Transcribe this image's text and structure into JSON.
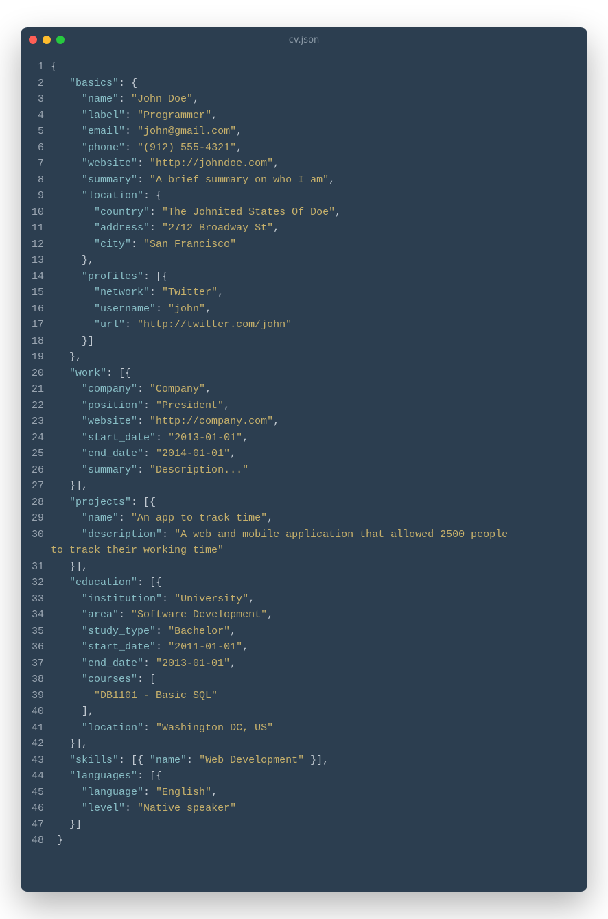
{
  "window": {
    "title": "cv.json"
  },
  "line_numbers": [
    "1",
    "2",
    "3",
    "4",
    "5",
    "6",
    "7",
    "8",
    "9",
    "10",
    "11",
    "12",
    "13",
    "14",
    "15",
    "16",
    "17",
    "18",
    "19",
    "20",
    "21",
    "22",
    "23",
    "24",
    "25",
    "26",
    "27",
    "28",
    "29",
    "30",
    "",
    "31",
    "32",
    "33",
    "34",
    "35",
    "36",
    "37",
    "38",
    "39",
    "40",
    "41",
    "42",
    "43",
    "44",
    "45",
    "46",
    "47",
    "48"
  ],
  "code_lines": [
    [
      {
        "t": "p",
        "x": "{"
      }
    ],
    [
      {
        "t": "p",
        "x": "   "
      },
      {
        "t": "k",
        "x": "\"basics\""
      },
      {
        "t": "p",
        "x": ": {"
      }
    ],
    [
      {
        "t": "p",
        "x": "     "
      },
      {
        "t": "k",
        "x": "\"name\""
      },
      {
        "t": "p",
        "x": ": "
      },
      {
        "t": "s",
        "x": "\"John Doe\""
      },
      {
        "t": "p",
        "x": ","
      }
    ],
    [
      {
        "t": "p",
        "x": "     "
      },
      {
        "t": "k",
        "x": "\"label\""
      },
      {
        "t": "p",
        "x": ": "
      },
      {
        "t": "s",
        "x": "\"Programmer\""
      },
      {
        "t": "p",
        "x": ","
      }
    ],
    [
      {
        "t": "p",
        "x": "     "
      },
      {
        "t": "k",
        "x": "\"email\""
      },
      {
        "t": "p",
        "x": ": "
      },
      {
        "t": "s",
        "x": "\"john@gmail.com\""
      },
      {
        "t": "p",
        "x": ","
      }
    ],
    [
      {
        "t": "p",
        "x": "     "
      },
      {
        "t": "k",
        "x": "\"phone\""
      },
      {
        "t": "p",
        "x": ": "
      },
      {
        "t": "s",
        "x": "\"(912) 555-4321\""
      },
      {
        "t": "p",
        "x": ","
      }
    ],
    [
      {
        "t": "p",
        "x": "     "
      },
      {
        "t": "k",
        "x": "\"website\""
      },
      {
        "t": "p",
        "x": ": "
      },
      {
        "t": "s",
        "x": "\"http://johndoe.com\""
      },
      {
        "t": "p",
        "x": ","
      }
    ],
    [
      {
        "t": "p",
        "x": "     "
      },
      {
        "t": "k",
        "x": "\"summary\""
      },
      {
        "t": "p",
        "x": ": "
      },
      {
        "t": "s",
        "x": "\"A brief summary on who I am\""
      },
      {
        "t": "p",
        "x": ","
      }
    ],
    [
      {
        "t": "p",
        "x": "     "
      },
      {
        "t": "k",
        "x": "\"location\""
      },
      {
        "t": "p",
        "x": ": {"
      }
    ],
    [
      {
        "t": "p",
        "x": "       "
      },
      {
        "t": "k",
        "x": "\"country\""
      },
      {
        "t": "p",
        "x": ": "
      },
      {
        "t": "s",
        "x": "\"The Johnited States Of Doe\""
      },
      {
        "t": "p",
        "x": ","
      }
    ],
    [
      {
        "t": "p",
        "x": "       "
      },
      {
        "t": "k",
        "x": "\"address\""
      },
      {
        "t": "p",
        "x": ": "
      },
      {
        "t": "s",
        "x": "\"2712 Broadway St\""
      },
      {
        "t": "p",
        "x": ","
      }
    ],
    [
      {
        "t": "p",
        "x": "       "
      },
      {
        "t": "k",
        "x": "\"city\""
      },
      {
        "t": "p",
        "x": ": "
      },
      {
        "t": "s",
        "x": "\"San Francisco\""
      }
    ],
    [
      {
        "t": "p",
        "x": "     },"
      }
    ],
    [
      {
        "t": "p",
        "x": "     "
      },
      {
        "t": "k",
        "x": "\"profiles\""
      },
      {
        "t": "p",
        "x": ": [{"
      }
    ],
    [
      {
        "t": "p",
        "x": "       "
      },
      {
        "t": "k",
        "x": "\"network\""
      },
      {
        "t": "p",
        "x": ": "
      },
      {
        "t": "s",
        "x": "\"Twitter\""
      },
      {
        "t": "p",
        "x": ","
      }
    ],
    [
      {
        "t": "p",
        "x": "       "
      },
      {
        "t": "k",
        "x": "\"username\""
      },
      {
        "t": "p",
        "x": ": "
      },
      {
        "t": "s",
        "x": "\"john\""
      },
      {
        "t": "p",
        "x": ","
      }
    ],
    [
      {
        "t": "p",
        "x": "       "
      },
      {
        "t": "k",
        "x": "\"url\""
      },
      {
        "t": "p",
        "x": ": "
      },
      {
        "t": "s",
        "x": "\"http://twitter.com/john\""
      }
    ],
    [
      {
        "t": "p",
        "x": "     }]"
      }
    ],
    [
      {
        "t": "p",
        "x": "   },"
      }
    ],
    [
      {
        "t": "p",
        "x": "   "
      },
      {
        "t": "k",
        "x": "\"work\""
      },
      {
        "t": "p",
        "x": ": [{"
      }
    ],
    [
      {
        "t": "p",
        "x": "     "
      },
      {
        "t": "k",
        "x": "\"company\""
      },
      {
        "t": "p",
        "x": ": "
      },
      {
        "t": "s",
        "x": "\"Company\""
      },
      {
        "t": "p",
        "x": ","
      }
    ],
    [
      {
        "t": "p",
        "x": "     "
      },
      {
        "t": "k",
        "x": "\"position\""
      },
      {
        "t": "p",
        "x": ": "
      },
      {
        "t": "s",
        "x": "\"President\""
      },
      {
        "t": "p",
        "x": ","
      }
    ],
    [
      {
        "t": "p",
        "x": "     "
      },
      {
        "t": "k",
        "x": "\"website\""
      },
      {
        "t": "p",
        "x": ": "
      },
      {
        "t": "s",
        "x": "\"http://company.com\""
      },
      {
        "t": "p",
        "x": ","
      }
    ],
    [
      {
        "t": "p",
        "x": "     "
      },
      {
        "t": "k",
        "x": "\"start_date\""
      },
      {
        "t": "p",
        "x": ": "
      },
      {
        "t": "s",
        "x": "\"2013-01-01\""
      },
      {
        "t": "p",
        "x": ","
      }
    ],
    [
      {
        "t": "p",
        "x": "     "
      },
      {
        "t": "k",
        "x": "\"end_date\""
      },
      {
        "t": "p",
        "x": ": "
      },
      {
        "t": "s",
        "x": "\"2014-01-01\""
      },
      {
        "t": "p",
        "x": ","
      }
    ],
    [
      {
        "t": "p",
        "x": "     "
      },
      {
        "t": "k",
        "x": "\"summary\""
      },
      {
        "t": "p",
        "x": ": "
      },
      {
        "t": "s",
        "x": "\"Description...\""
      }
    ],
    [
      {
        "t": "p",
        "x": "   }],"
      }
    ],
    [
      {
        "t": "p",
        "x": "   "
      },
      {
        "t": "k",
        "x": "\"projects\""
      },
      {
        "t": "p",
        "x": ": [{"
      }
    ],
    [
      {
        "t": "p",
        "x": "     "
      },
      {
        "t": "k",
        "x": "\"name\""
      },
      {
        "t": "p",
        "x": ": "
      },
      {
        "t": "s",
        "x": "\"An app to track time\""
      },
      {
        "t": "p",
        "x": ","
      }
    ],
    [
      {
        "t": "p",
        "x": "     "
      },
      {
        "t": "k",
        "x": "\"description\""
      },
      {
        "t": "p",
        "x": ": "
      },
      {
        "t": "s",
        "x": "\"A web and mobile application that allowed 2500 people"
      }
    ],
    [
      {
        "t": "s",
        "x": "to track their working time\""
      }
    ],
    [
      {
        "t": "p",
        "x": "   }],"
      }
    ],
    [
      {
        "t": "p",
        "x": "   "
      },
      {
        "t": "k",
        "x": "\"education\""
      },
      {
        "t": "p",
        "x": ": [{"
      }
    ],
    [
      {
        "t": "p",
        "x": "     "
      },
      {
        "t": "k",
        "x": "\"institution\""
      },
      {
        "t": "p",
        "x": ": "
      },
      {
        "t": "s",
        "x": "\"University\""
      },
      {
        "t": "p",
        "x": ","
      }
    ],
    [
      {
        "t": "p",
        "x": "     "
      },
      {
        "t": "k",
        "x": "\"area\""
      },
      {
        "t": "p",
        "x": ": "
      },
      {
        "t": "s",
        "x": "\"Software Development\""
      },
      {
        "t": "p",
        "x": ","
      }
    ],
    [
      {
        "t": "p",
        "x": "     "
      },
      {
        "t": "k",
        "x": "\"study_type\""
      },
      {
        "t": "p",
        "x": ": "
      },
      {
        "t": "s",
        "x": "\"Bachelor\""
      },
      {
        "t": "p",
        "x": ","
      }
    ],
    [
      {
        "t": "p",
        "x": "     "
      },
      {
        "t": "k",
        "x": "\"start_date\""
      },
      {
        "t": "p",
        "x": ": "
      },
      {
        "t": "s",
        "x": "\"2011-01-01\""
      },
      {
        "t": "p",
        "x": ","
      }
    ],
    [
      {
        "t": "p",
        "x": "     "
      },
      {
        "t": "k",
        "x": "\"end_date\""
      },
      {
        "t": "p",
        "x": ": "
      },
      {
        "t": "s",
        "x": "\"2013-01-01\""
      },
      {
        "t": "p",
        "x": ","
      }
    ],
    [
      {
        "t": "p",
        "x": "     "
      },
      {
        "t": "k",
        "x": "\"courses\""
      },
      {
        "t": "p",
        "x": ": ["
      }
    ],
    [
      {
        "t": "p",
        "x": "       "
      },
      {
        "t": "s",
        "x": "\"DB1101 - Basic SQL\""
      }
    ],
    [
      {
        "t": "p",
        "x": "     ],"
      }
    ],
    [
      {
        "t": "p",
        "x": "     "
      },
      {
        "t": "k",
        "x": "\"location\""
      },
      {
        "t": "p",
        "x": ": "
      },
      {
        "t": "s",
        "x": "\"Washington DC, US\""
      }
    ],
    [
      {
        "t": "p",
        "x": "   }],"
      }
    ],
    [
      {
        "t": "p",
        "x": "   "
      },
      {
        "t": "k",
        "x": "\"skills\""
      },
      {
        "t": "p",
        "x": ": [{ "
      },
      {
        "t": "k",
        "x": "\"name\""
      },
      {
        "t": "p",
        "x": ": "
      },
      {
        "t": "s",
        "x": "\"Web Development\""
      },
      {
        "t": "p",
        "x": " }],"
      }
    ],
    [
      {
        "t": "p",
        "x": "   "
      },
      {
        "t": "k",
        "x": "\"languages\""
      },
      {
        "t": "p",
        "x": ": [{"
      }
    ],
    [
      {
        "t": "p",
        "x": "     "
      },
      {
        "t": "k",
        "x": "\"language\""
      },
      {
        "t": "p",
        "x": ": "
      },
      {
        "t": "s",
        "x": "\"English\""
      },
      {
        "t": "p",
        "x": ","
      }
    ],
    [
      {
        "t": "p",
        "x": "     "
      },
      {
        "t": "k",
        "x": "\"level\""
      },
      {
        "t": "p",
        "x": ": "
      },
      {
        "t": "s",
        "x": "\"Native speaker\""
      }
    ],
    [
      {
        "t": "p",
        "x": "   }]"
      }
    ],
    [
      {
        "t": "p",
        "x": " }"
      }
    ]
  ]
}
